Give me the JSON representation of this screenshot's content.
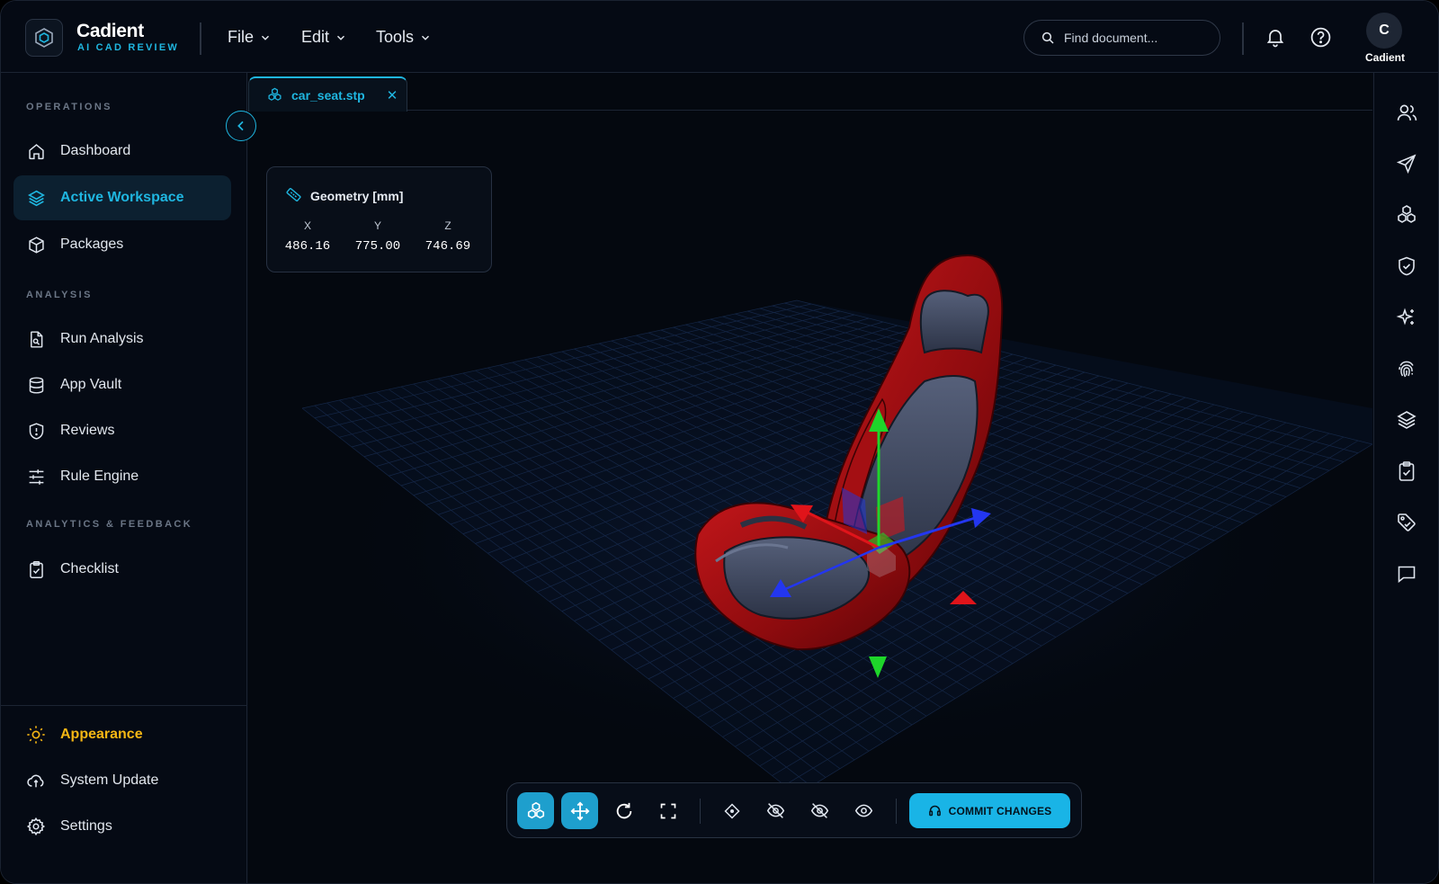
{
  "brand": {
    "name": "Cadient",
    "subtitle": "AI CAD REVIEW"
  },
  "menus": [
    {
      "label": "File"
    },
    {
      "label": "Edit"
    },
    {
      "label": "Tools"
    }
  ],
  "search": {
    "placeholder": "Find document..."
  },
  "user": {
    "initial": "C",
    "name": "Cadient"
  },
  "sidebar": {
    "sections": [
      "OPERATIONS",
      "ANALYSIS",
      "ANALYTICS & FEEDBACK"
    ],
    "items": [
      {
        "label": "Dashboard",
        "icon": "home-icon"
      },
      {
        "label": "Active Workspace",
        "icon": "layers-icon",
        "active": true
      },
      {
        "label": "Packages",
        "icon": "package-icon"
      },
      {
        "label": "Run Analysis",
        "icon": "file-analysis-icon"
      },
      {
        "label": "App Vault",
        "icon": "database-icon"
      },
      {
        "label": "Reviews",
        "icon": "shield-alert-icon"
      },
      {
        "label": "Rule Engine",
        "icon": "sliders-icon"
      },
      {
        "label": "Checklist",
        "icon": "clipboard-check-icon"
      }
    ],
    "bottom": [
      {
        "label": "Appearance",
        "icon": "sun-icon",
        "color": "#f5b614"
      },
      {
        "label": "System Update",
        "icon": "cloud-sync-icon"
      },
      {
        "label": "Settings",
        "icon": "gear-icon"
      }
    ]
  },
  "tab": {
    "label": "car_seat.stp",
    "close": "✕"
  },
  "geometry": {
    "title": "Geometry [mm]",
    "axes": [
      {
        "axis": "X",
        "value": "486.16"
      },
      {
        "axis": "Y",
        "value": "775.00"
      },
      {
        "axis": "Z",
        "value": "746.69"
      }
    ]
  },
  "toolbar": {
    "commit_label": "COMMIT CHANGES"
  },
  "right_rail": [
    "users-icon",
    "send-icon",
    "components-icon",
    "shield-check-icon",
    "sparkles-icon",
    "fingerprint-icon",
    "layers-icon",
    "clipboard-check-icon",
    "tag-icon",
    "message-icon"
  ],
  "colors": {
    "accent": "#1fb6e0",
    "appearance": "#f5b614",
    "background": "#050a14",
    "seat": "#a00d10"
  }
}
